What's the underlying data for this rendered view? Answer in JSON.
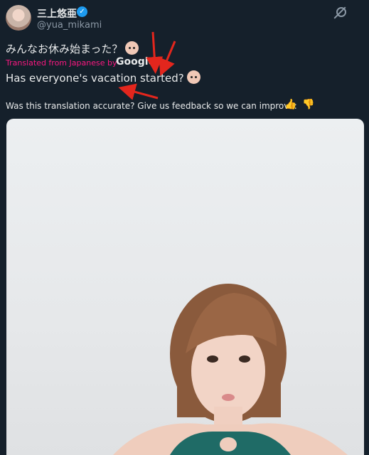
{
  "author": {
    "name": "三上悠亜",
    "handle": "@yua_mikami"
  },
  "tweet": {
    "original_text": "みんなお休み始まった？",
    "translated_prefix": "Translated from Japanese by",
    "translator": "Google",
    "translated_text": "Has everyone's vacation started?",
    "feedback_prompt": "Was this translation accurate? Give us feedback so we can improve:"
  },
  "icons": [
    "verified-badge-icon",
    "grok-icon",
    "thumbs-up-icon",
    "thumbs-down-icon",
    "baby-emoji-icon"
  ],
  "colors": {
    "background": "#15202b",
    "translation_label": "#f91880",
    "verified": "#1d9bf0",
    "annotation_arrows": "#e3261d"
  }
}
